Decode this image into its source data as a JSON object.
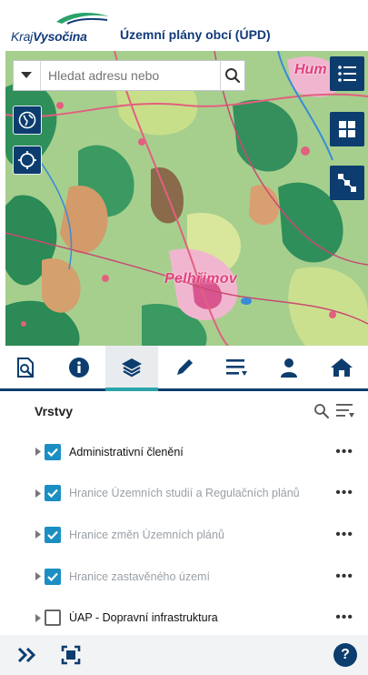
{
  "header": {
    "logo_prefix": "Kraj",
    "logo_brand": "Vysočina",
    "title": "Územní plány obcí (ÚPD)"
  },
  "map": {
    "search_placeholder": "Hledat adresu nebo",
    "labels": {
      "town_main": "Pelhřimov",
      "town_corner": "Hum"
    },
    "left_buttons": [
      {
        "icon": "globe-icon"
      },
      {
        "icon": "crosshair-icon"
      }
    ],
    "right_buttons": [
      {
        "icon": "list-icon"
      },
      {
        "icon": "grid-icon"
      },
      {
        "icon": "network-icon"
      }
    ]
  },
  "toolbar": {
    "items": [
      {
        "icon": "search-document-icon",
        "active": false
      },
      {
        "icon": "info-icon",
        "active": false
      },
      {
        "icon": "layers-icon",
        "active": true
      },
      {
        "icon": "pencil-icon",
        "active": false
      },
      {
        "icon": "legend-list-icon",
        "active": false
      },
      {
        "icon": "user-icon",
        "active": false
      },
      {
        "icon": "home-icon",
        "active": false
      }
    ]
  },
  "layers_panel": {
    "title": "Vrstvy",
    "items": [
      {
        "label": "Administrativní členění",
        "checked": true,
        "muted": false
      },
      {
        "label": "Hranice Územních studií a Regulačních plánů",
        "checked": true,
        "muted": true
      },
      {
        "label": "Hranice změn Územních plánů",
        "checked": true,
        "muted": true
      },
      {
        "label": "Hranice zastavěného území",
        "checked": true,
        "muted": true
      },
      {
        "label": "ÚAP - Dopravní infrastruktura",
        "checked": false,
        "muted": false
      }
    ],
    "more_glyph": "•••"
  },
  "footer": {
    "help_label": "?"
  },
  "colors": {
    "brand_navy": "#0c3d6e",
    "accent_teal": "#2aa3a9",
    "checkbox_blue": "#1b8fc2",
    "map_label_pink": "#e0417b"
  }
}
